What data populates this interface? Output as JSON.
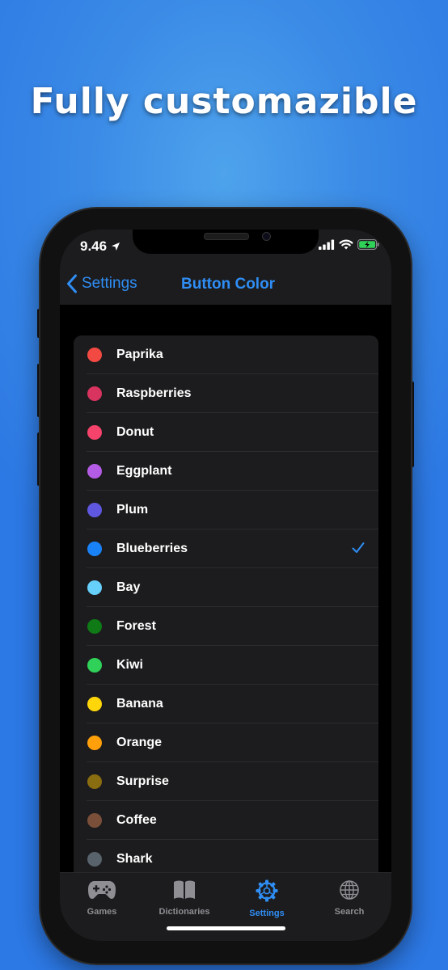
{
  "headline": "Fully customazible",
  "status": {
    "time": "9.46"
  },
  "nav": {
    "back_label": "Settings",
    "title": "Button Color",
    "accent": "#2f8ef5"
  },
  "colors": [
    {
      "name": "Paprika",
      "hex": "#f24a43",
      "selected": false
    },
    {
      "name": "Raspberries",
      "hex": "#d9335f",
      "selected": false
    },
    {
      "name": "Donut",
      "hex": "#f6436b",
      "selected": false
    },
    {
      "name": "Eggplant",
      "hex": "#b55ce6",
      "selected": false
    },
    {
      "name": "Plum",
      "hex": "#5f57e0",
      "selected": false
    },
    {
      "name": "Blueberries",
      "hex": "#1a82f7",
      "selected": true
    },
    {
      "name": "Bay",
      "hex": "#66cffa",
      "selected": false
    },
    {
      "name": "Forest",
      "hex": "#0f7a16",
      "selected": false
    },
    {
      "name": "Kiwi",
      "hex": "#30d158",
      "selected": false
    },
    {
      "name": "Banana",
      "hex": "#ffd60a",
      "selected": false
    },
    {
      "name": "Orange",
      "hex": "#ff9f0a",
      "selected": false
    },
    {
      "name": "Surprise",
      "hex": "#8a6d10",
      "selected": false
    },
    {
      "name": "Coffee",
      "hex": "#7a4f3a",
      "selected": false
    },
    {
      "name": "Shark",
      "hex": "#59636b",
      "selected": false
    }
  ],
  "tabs": [
    {
      "label": "Games",
      "icon": "gamepad-icon",
      "active": false
    },
    {
      "label": "Dictionaries",
      "icon": "book-icon",
      "active": false
    },
    {
      "label": "Settings",
      "icon": "gear-icon",
      "active": true
    },
    {
      "label": "Search",
      "icon": "globe-icon",
      "active": false
    }
  ]
}
